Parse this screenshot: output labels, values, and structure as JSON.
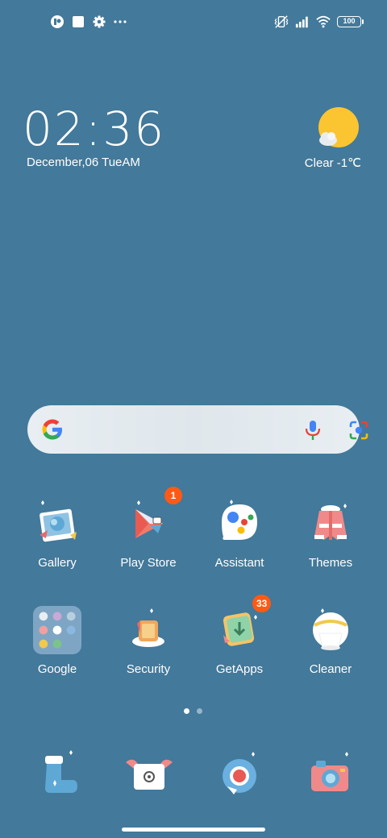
{
  "status_bar": {
    "battery_level": "100",
    "left_icons": [
      "notification-app-icon",
      "square-icon",
      "settings-icon",
      "more-dots-icon"
    ],
    "right_icons": [
      "vibrate-off-icon",
      "signal-icon",
      "wifi-icon",
      "battery-icon"
    ]
  },
  "clock_widget": {
    "time": "02:36",
    "date": "December,06 TueAM"
  },
  "weather_widget": {
    "condition": "Clear",
    "temperature": "-1℃",
    "text": "Clear  -1℃",
    "icon": "sun-cloud-icon"
  },
  "search_bar": {
    "icons": [
      "google-logo-icon",
      "microphone-icon",
      "lens-camera-icon"
    ]
  },
  "apps": [
    {
      "label": "Gallery",
      "icon": "gallery-icon"
    },
    {
      "label": "Play Store",
      "icon": "play-store-icon",
      "badge": "1"
    },
    {
      "label": "Assistant",
      "icon": "assistant-icon"
    },
    {
      "label": "Themes",
      "icon": "themes-icon"
    },
    {
      "label": "Google",
      "icon": "google-folder-icon"
    },
    {
      "label": "Security",
      "icon": "security-icon"
    },
    {
      "label": "GetApps",
      "icon": "getapps-icon",
      "badge": "33"
    },
    {
      "label": "Cleaner",
      "icon": "cleaner-icon"
    }
  ],
  "page_indicator": {
    "pages": 2,
    "active": 1
  },
  "dock": [
    {
      "icon": "phone-stocking-icon"
    },
    {
      "icon": "messages-envelope-icon"
    },
    {
      "icon": "chrome-icon"
    },
    {
      "icon": "camera-icon"
    }
  ],
  "colors": {
    "background": "#43799a",
    "badge": "#ff5a14",
    "sun": "#fbc531"
  }
}
